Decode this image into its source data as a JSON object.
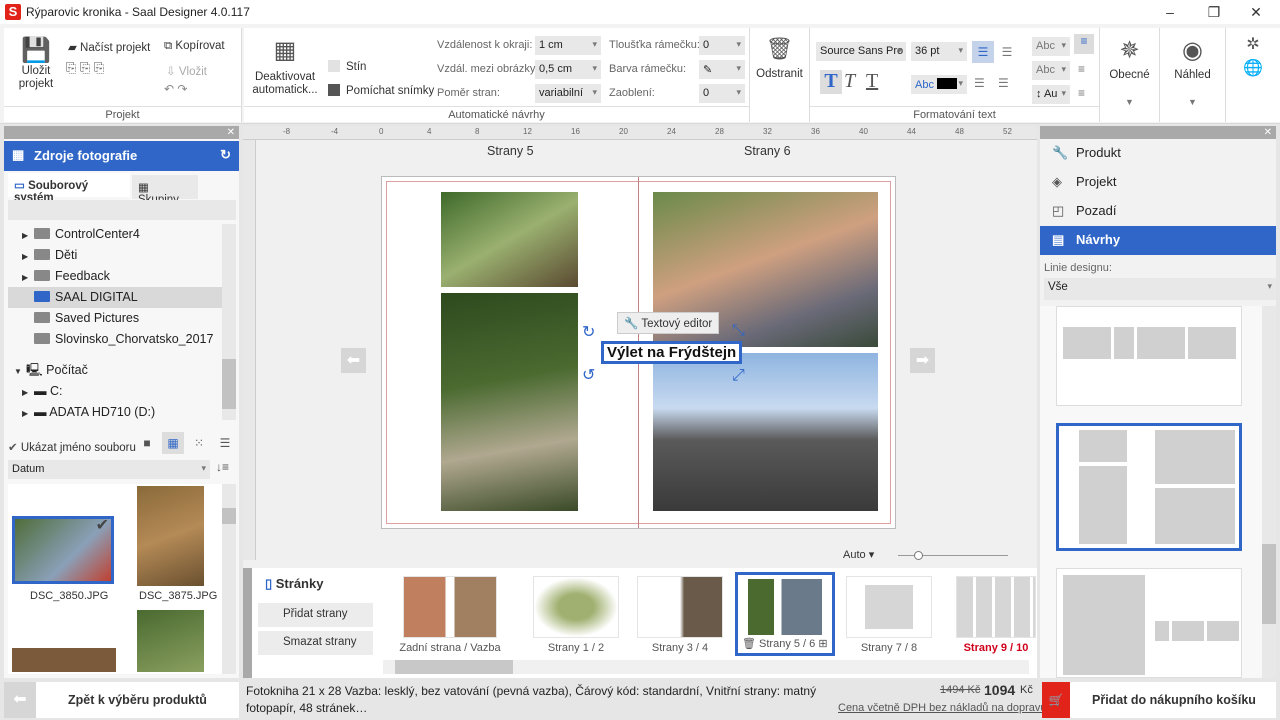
{
  "window": {
    "title": "Rýparovic kronika - Saal Designer 4.0.117",
    "logo": "S"
  },
  "ribbon": {
    "project": {
      "save": "Uložit projekt",
      "load": "Načíst projekt",
      "copy": "Kopírovat",
      "paste": "Vložit",
      "group": "Projekt"
    },
    "auto": {
      "deactivate": "Deaktivovat automatick...",
      "shadow": "Stín",
      "shuffle": "Pomíchat snímky",
      "margin_label": "Vzdálenost k okraji:",
      "margin_value": "1 cm",
      "gap_label": "Vzdál. mezi obrázky:",
      "gap_value": "0,5 cm",
      "ratio_label": "Poměr stran:",
      "ratio_value": "variabilní",
      "border_w_label": "Tloušťka rámečku:",
      "border_w_value": "0",
      "border_c_label": "Barva rámečku:",
      "round_label": "Zaoblení:",
      "round_value": "0",
      "group": "Automatické návrhy"
    },
    "remove": "Odstranit",
    "text": {
      "font": "Source Sans Pro",
      "size": "36 pt",
      "abc": "Abc",
      "line_spacing": "Au",
      "group": "Formatování text",
      "color": "#000000"
    },
    "general": "Obecné",
    "preview": "Náhled"
  },
  "left": {
    "title": "Zdroje fotografie",
    "tabs": [
      "Souborový systém",
      "Skupiny"
    ],
    "tree": [
      {
        "label": "ControlCenter4",
        "expandable": true
      },
      {
        "label": "Děti",
        "expandable": true
      },
      {
        "label": "Feedback",
        "expandable": true
      },
      {
        "label": "SAAL DIGITAL",
        "selected": true
      },
      {
        "label": "Saved Pictures"
      },
      {
        "label": "Slovinsko_Chorvatsko_2017"
      }
    ],
    "computer": "Počítač",
    "drives": [
      "C:",
      "ADATA HD710 (D:)"
    ],
    "show_filename": "Ukázat jméno souboru",
    "sort": "Datum",
    "files": [
      "DSC_3850.JPG",
      "DSC_3875.JPG"
    ]
  },
  "canvas": {
    "page_left": "Strany 5",
    "page_right": "Strany 6",
    "text_editor": "Textový editor",
    "text_box": "Výlet na Frýdštejn",
    "zoom": "Auto",
    "ruler": [
      "-8",
      "-4",
      "0",
      "4",
      "8",
      "12",
      "16",
      "20",
      "24",
      "28",
      "32",
      "36",
      "40",
      "44",
      "48",
      "52"
    ]
  },
  "pages": {
    "title": "Stránky",
    "add": "Přidat strany",
    "delete": "Smazat strany",
    "thumbs": [
      "Zadní strana / Vazba",
      "Strany 1 / 2",
      "Strany 3 / 4",
      "Strany 5 / 6",
      "Strany 7 / 8",
      "Strany 9 / 10"
    ],
    "selected": "Strany 5 / 6",
    "warning_color": "#d0021b"
  },
  "right": {
    "items": [
      "Produkt",
      "Projekt",
      "Pozadí",
      "Návrhy"
    ],
    "active": "Návrhy",
    "design_line_label": "Linie designu:",
    "design_line_value": "Vše"
  },
  "bottom": {
    "back": "Zpět k výběru produktů",
    "description": "Fotokniha 21 x 28 Vazba: lesklý, bez vatování (pevná vazba), Čárový kód: standardní, Vnitřní strany: matný fotopapír, 48 stránek…",
    "old_price": "1494 Kč",
    "price": "1094",
    "currency": "Kč",
    "price_note": "Cena včetně DPH bez nákladů na dopravu",
    "cart": "Přidat do nákupního košíku"
  },
  "colors": {
    "accent": "#2f66c8",
    "cart": "#e2231a"
  }
}
